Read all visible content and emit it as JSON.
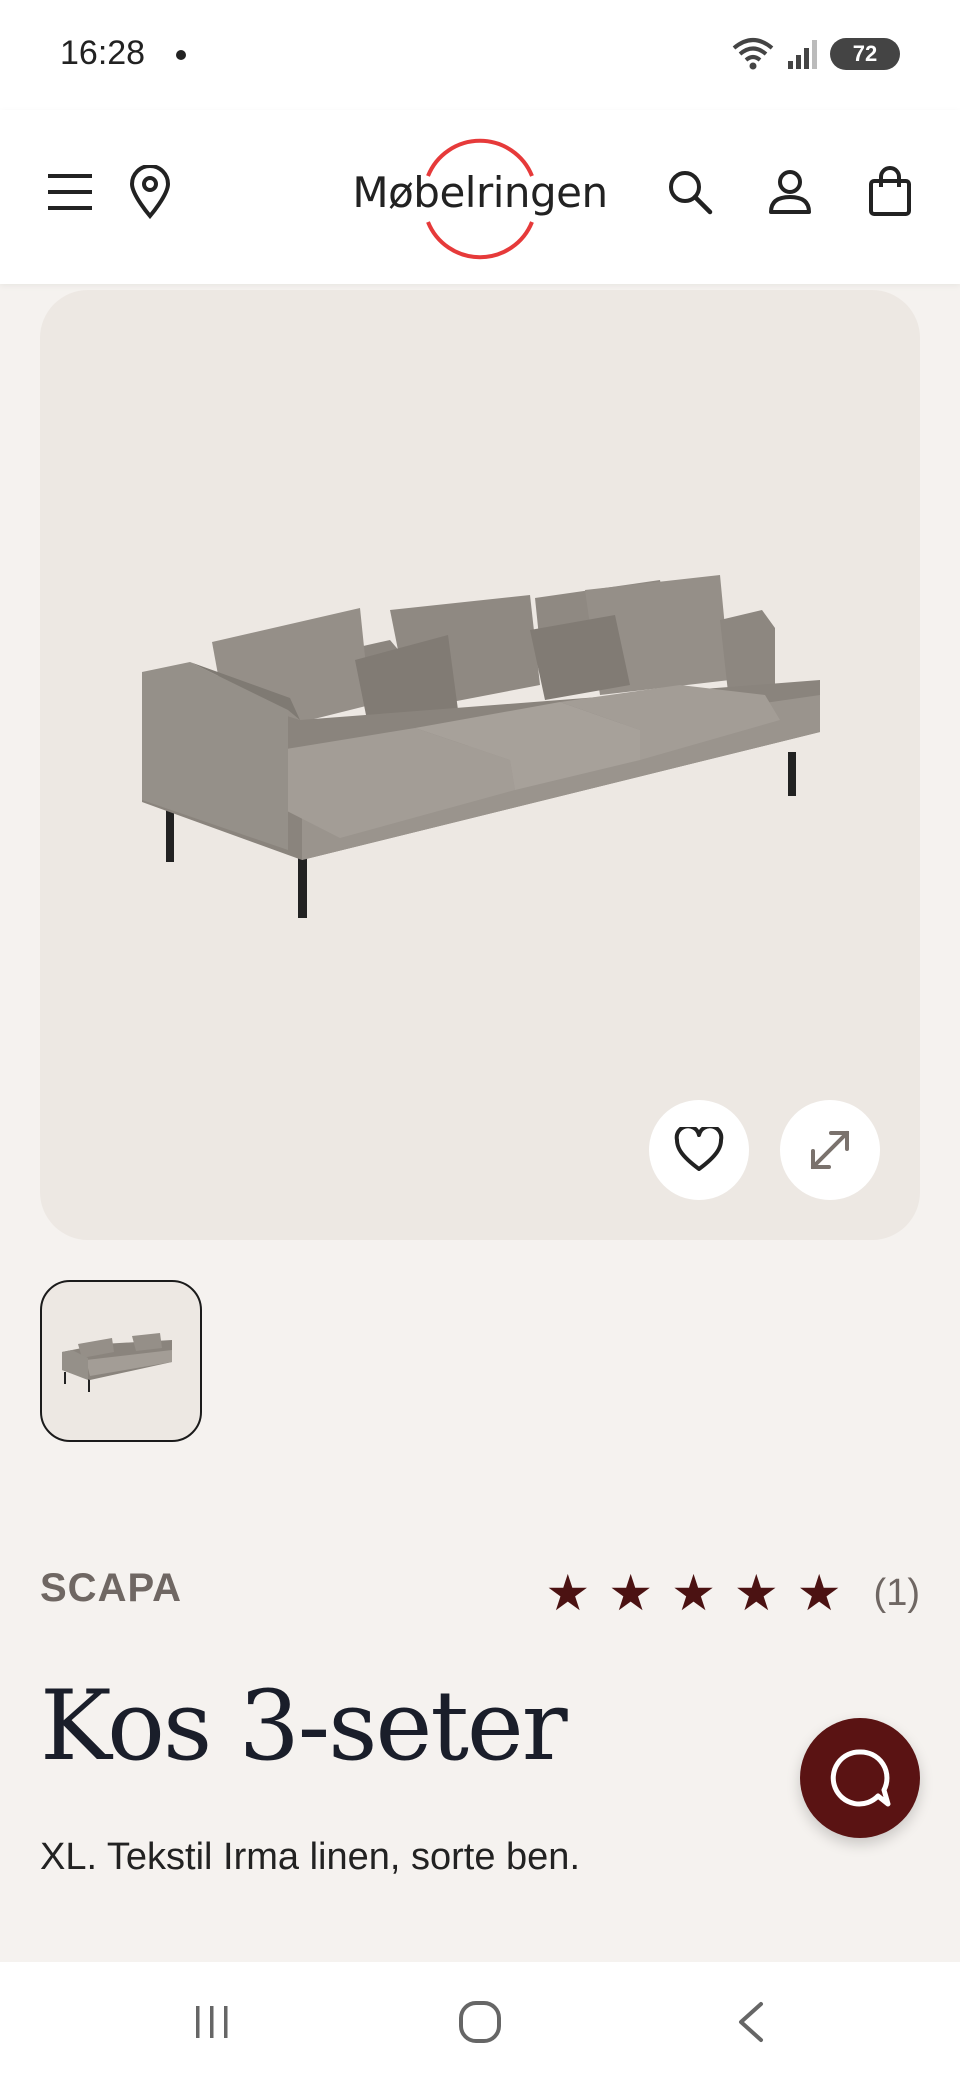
{
  "status_bar": {
    "time": "16:28",
    "battery": "72"
  },
  "header": {
    "logo_text": "Møbelringen"
  },
  "product": {
    "brand": "SCAPA",
    "review_count": "(1)",
    "rating": 5,
    "title": "Kos 3-seter",
    "subtitle": "XL. Tekstil Irma linen, sorte ben."
  },
  "icons": {
    "menu": "hamburger-menu-icon",
    "location": "location-pin-icon",
    "search": "search-icon",
    "account": "user-icon",
    "cart": "shopping-bag-icon",
    "favorite": "heart-icon",
    "expand": "expand-icon",
    "chat": "chat-icon"
  },
  "colors": {
    "accent": "#5a1313",
    "star": "#4b1212",
    "logo_ring": "#e63a3a",
    "page_bg": "#f5f2ef",
    "gallery_bg": "#ede8e3"
  }
}
